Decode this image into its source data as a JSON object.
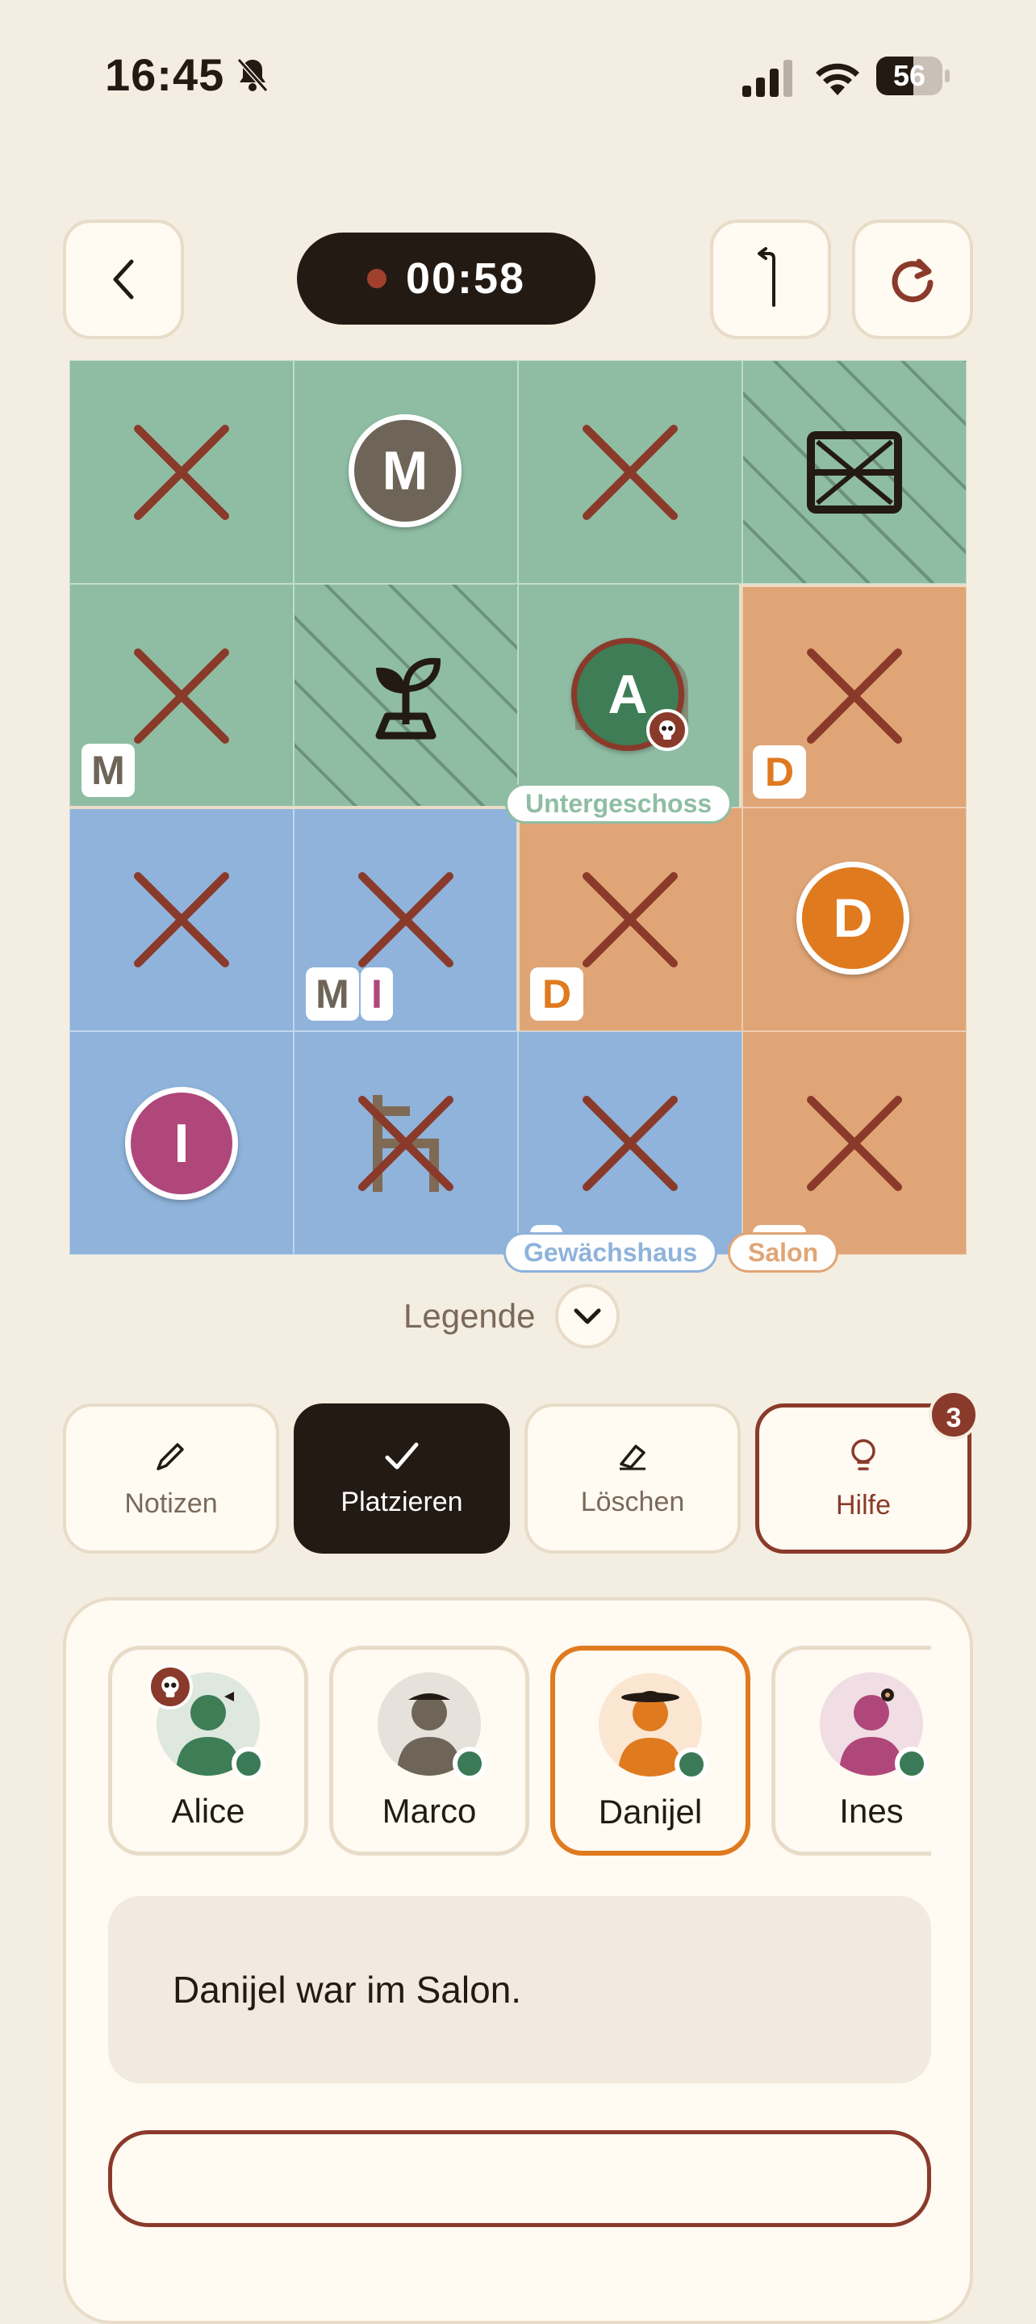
{
  "status_bar": {
    "time": "16:45",
    "battery": "56",
    "battery_level": 0.56
  },
  "timer": {
    "value": "00:58"
  },
  "board": {
    "room_labels": {
      "basement": "Untergeschoss",
      "greenhouse": "Gewächshaus",
      "salon": "Salon"
    },
    "tokens": {
      "marco": "M",
      "alice": "A",
      "danijel": "D",
      "ines": "I"
    },
    "tags": {
      "m": "M",
      "d": "D",
      "i": "I"
    }
  },
  "legend": {
    "label": "Legende"
  },
  "actions": {
    "notes": "Notizen",
    "place": "Platzieren",
    "erase": "Löschen",
    "help": "Hilfe",
    "help_badge": "3"
  },
  "suspects": [
    {
      "name": "Alice",
      "color": "#3E7D55"
    },
    {
      "name": "Marco",
      "color": "#6E6558"
    },
    {
      "name": "Danijel",
      "color": "#E07A1F"
    },
    {
      "name": "Ines",
      "color": "#B0477A"
    }
  ],
  "statement": {
    "text": "Danijel war im Salon."
  },
  "colors": {
    "green_room": "#8FBDA4",
    "orange_room": "#E0A576",
    "blue_room": "#8FB3DB",
    "cross": "#8A3A2A",
    "accent": "#E07A1F"
  }
}
